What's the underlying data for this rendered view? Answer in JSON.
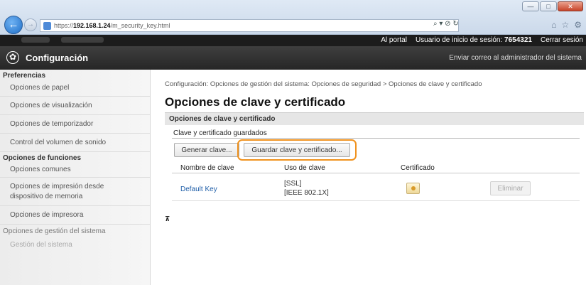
{
  "browser": {
    "url_prefix": "https://",
    "url_host": "192.168.1.24",
    "url_path": "/m_security_key.html",
    "addr_tools": "⌕ ▾ ⊘ ↻"
  },
  "topbar": {
    "portal": "Al portal",
    "user_label": "Usuario de inicio de sesión:",
    "user_id": "7654321",
    "logout": "Cerrar sesión"
  },
  "header": {
    "title": "Configuración",
    "mail_link": "Enviar correo al administrador del sistema"
  },
  "sidebar": {
    "section1": "Preferencias",
    "items1": [
      "Opciones de papel",
      "Opciones de visualización",
      "Opciones de temporizador",
      "Control del volumen de sonido"
    ],
    "section2": "Opciones de funciones",
    "items2": [
      "Opciones comunes",
      "Opciones de impresión desde dispositivo de memoria",
      "Opciones de impresora"
    ],
    "section3": "Opciones de gestión del sistema",
    "item_faded": "Gestión del sistema"
  },
  "main": {
    "breadcrumb": "Configuración: Opciones de gestión del sistema: Opciones de seguridad > Opciones de clave y certificado",
    "title": "Opciones de clave y certificado",
    "section": "Opciones de clave y certificado",
    "subtitle": "Clave y certificado guardados",
    "btn_generate": "Generar clave...",
    "btn_save": "Guardar clave y certificado...",
    "columns": [
      "Nombre de clave",
      "Uso de clave",
      "Certificado"
    ],
    "rows": [
      {
        "name": "Default Key",
        "usage1": "[SSL]",
        "usage2": "[IEEE 802.1X]",
        "delete": "Eliminar"
      }
    ]
  }
}
